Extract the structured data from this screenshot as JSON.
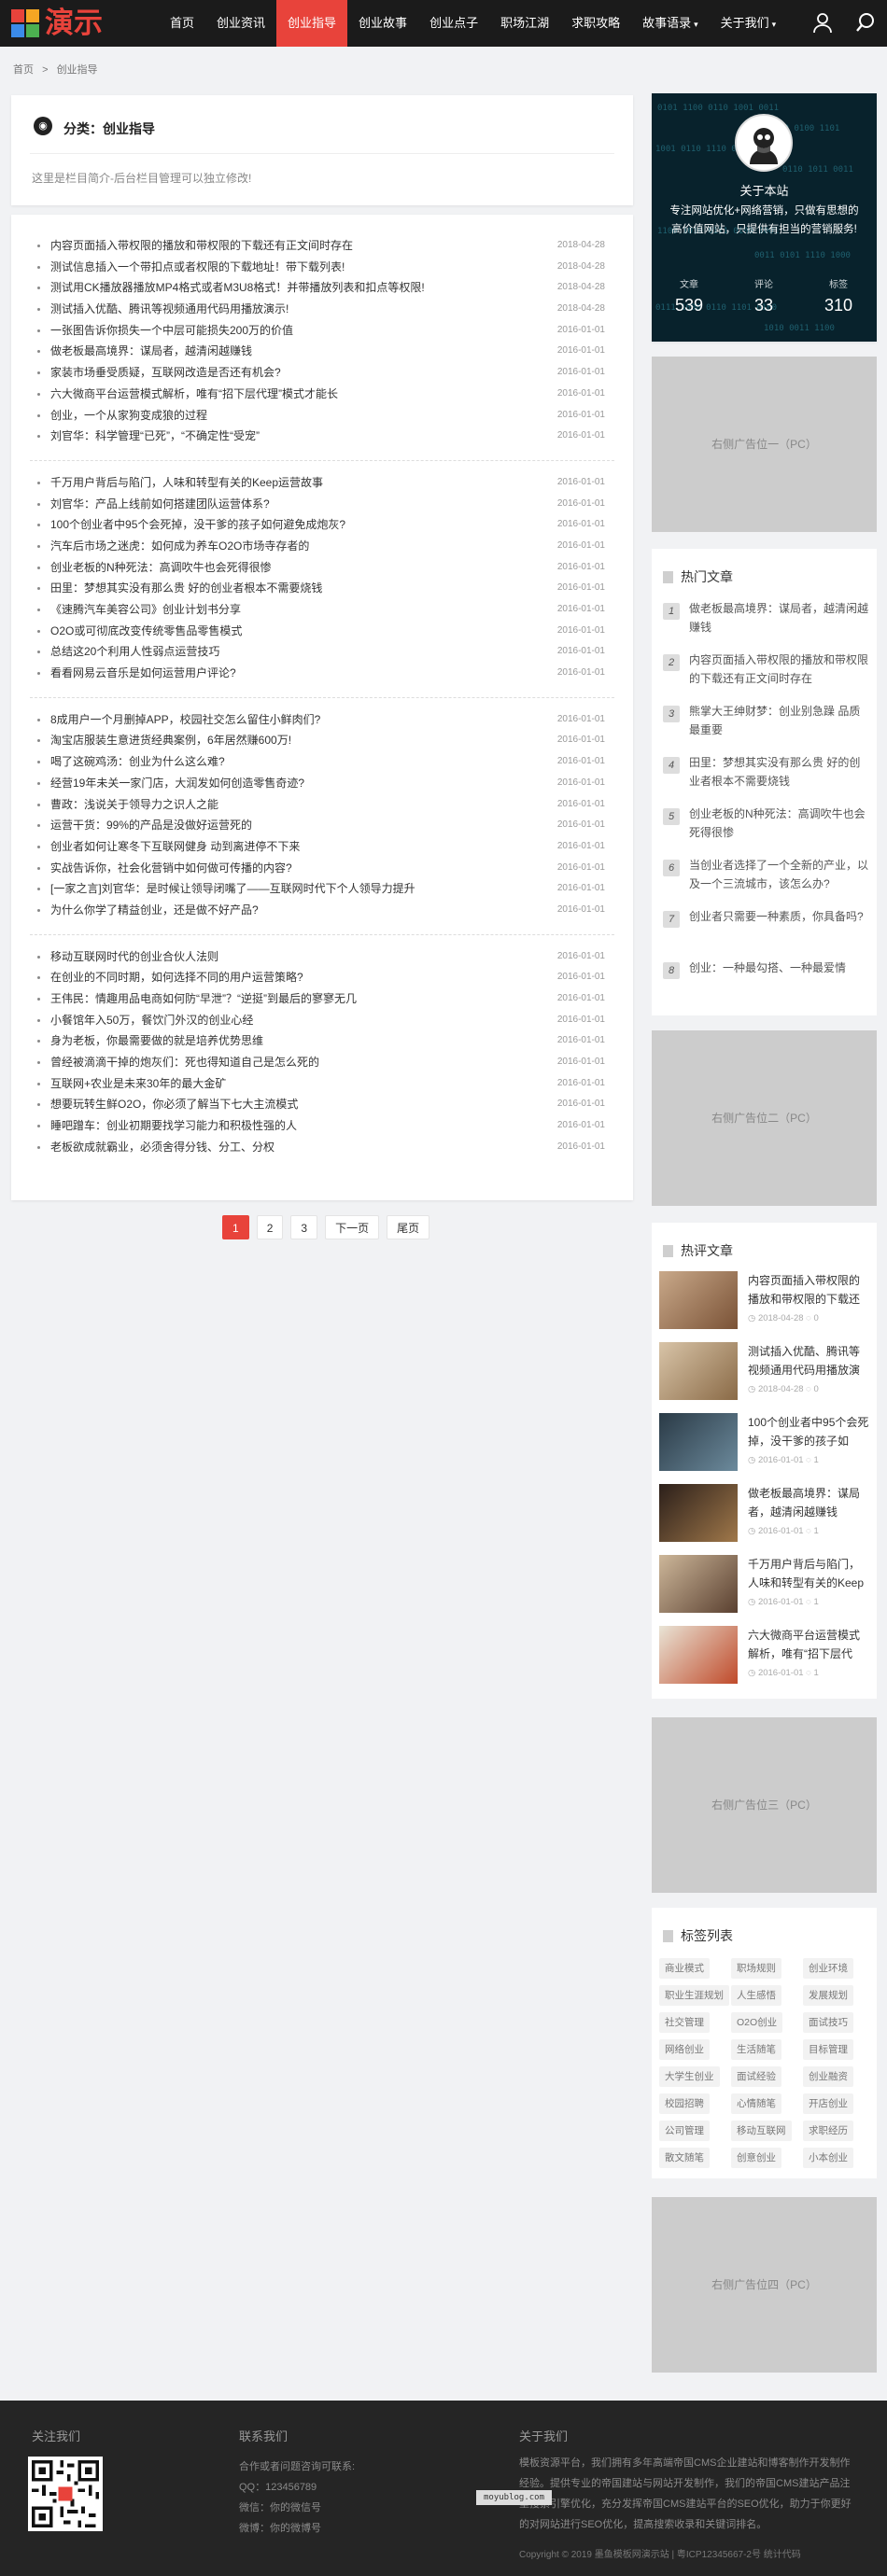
{
  "nav": {
    "logo_text": "演示",
    "items": [
      "首页",
      "创业资讯",
      "创业指导",
      "创业故事",
      "创业点子",
      "职场江湖",
      "求职攻略",
      "故事语录",
      "关于我们"
    ],
    "active_index": 2,
    "user_icon": "user-icon",
    "search_icon": "search-icon"
  },
  "breadcrumb": {
    "home": "首页",
    "sep": ">",
    "current": "创业指导"
  },
  "category": {
    "title": "分类：创业指导",
    "desc": "这里是栏目简介-后台栏目管理可以独立修改!"
  },
  "articles": [
    {
      "t": "内容页面插入带权限的播放和带权限的下载还有正文间时存在",
      "d": "2018-04-28"
    },
    {
      "t": "测试信息插入一个带扣点或者权限的下载地址！带下载列表!",
      "d": "2018-04-28"
    },
    {
      "t": "测试用CK播放器播放MP4格式或者M3U8格式！并带播放列表和扣点等权限!",
      "d": "2018-04-28"
    },
    {
      "t": "测试插入优酷、腾讯等视频通用代码用播放演示!",
      "d": "2018-04-28"
    },
    {
      "t": "一张图告诉你损失一个中层可能损失200万的价值",
      "d": "2016-01-01"
    },
    {
      "t": "做老板最高境界：谋局者，越清闲越赚钱",
      "d": "2016-01-01"
    },
    {
      "t": "家装市场垂受质疑，互联网改造是否还有机会?",
      "d": "2016-01-01"
    },
    {
      "t": "六大微商平台运营模式解析，唯有“招下层代理”模式才能长",
      "d": "2016-01-01"
    },
    {
      "t": "创业，一个从家狗变成狼的过程",
      "d": "2016-01-01"
    },
    {
      "t": "刘官华：科学管理“已死”，“不确定性“受宠”",
      "d": "2016-01-01"
    },
    {
      "t": "千万用户背后与陷门，人味和转型有关的Keep运营故事",
      "d": "2016-01-01"
    },
    {
      "t": "刘官华：产品上线前如何搭建团队运营体系?",
      "d": "2016-01-01"
    },
    {
      "t": "100个创业者中95个会死掉，没干爹的孩子如何避免成炮灰?",
      "d": "2016-01-01"
    },
    {
      "t": "汽车后市场之迷虎：如何成为养车O2O市场寺存者的",
      "d": "2016-01-01"
    },
    {
      "t": "创业老板的N种死法：高调吹牛也会死得很惨",
      "d": "2016-01-01"
    },
    {
      "t": "田里：梦想其实没有那么贵 好的创业者根本不需要烧钱",
      "d": "2016-01-01"
    },
    {
      "t": "《速腾汽车美容公司》创业计划书分享",
      "d": "2016-01-01"
    },
    {
      "t": "O2O或可彻底改变传统零售品零售模式",
      "d": "2016-01-01"
    },
    {
      "t": "总结这20个利用人性弱点运营技巧",
      "d": "2016-01-01"
    },
    {
      "t": "看看网易云音乐是如何运营用户评论?",
      "d": "2016-01-01"
    },
    {
      "t": "8成用户一个月删掉APP，校园社交怎么留住小鲜肉们?",
      "d": "2016-01-01"
    },
    {
      "t": "淘宝店服装生意进货经典案例，6年居然赚600万!",
      "d": "2016-01-01"
    },
    {
      "t": "喝了这碗鸡汤：创业为什么这么难?",
      "d": "2016-01-01"
    },
    {
      "t": "经营19年未关一家门店，大润发如何创造零售奇迹?",
      "d": "2016-01-01"
    },
    {
      "t": "曹政：浅说关于领导力之识人之能",
      "d": "2016-01-01"
    },
    {
      "t": "运营干货：99%的产品是没做好运营死的",
      "d": "2016-01-01"
    },
    {
      "t": "创业者如何让寒冬下互联网健身 动到离进停不下来",
      "d": "2016-01-01"
    },
    {
      "t": "实战告诉你，社会化营销中如何做可传播的内容?",
      "d": "2016-01-01"
    },
    {
      "t": "[一家之言]刘官华：是时候让领导闭嘴了——互联网时代下个人领导力提升",
      "d": "2016-01-01"
    },
    {
      "t": "为什么你学了精益创业，还是做不好产品?",
      "d": "2016-01-01"
    },
    {
      "t": "移动互联网时代的创业合伙人法则",
      "d": "2016-01-01"
    },
    {
      "t": "在创业的不同时期，如何选择不同的用户运营策略?",
      "d": "2016-01-01"
    },
    {
      "t": "王伟民：情趣用品电商如何防“早泄”？“逆挺”到最后的寥寥无几",
      "d": "2016-01-01"
    },
    {
      "t": "小餐馆年入50万，餐饮门外汉的创业心经",
      "d": "2016-01-01"
    },
    {
      "t": "身为老板，你最需要做的就是培养优势思维",
      "d": "2016-01-01"
    },
    {
      "t": "曾经被滴滴干掉的炮灰们：死也得知道自己是怎么死的",
      "d": "2016-01-01"
    },
    {
      "t": "互联网+农业是未来30年的最大金矿",
      "d": "2016-01-01"
    },
    {
      "t": "想要玩转生鲜O2O，你必须了解当下七大主流模式",
      "d": "2016-01-01"
    },
    {
      "t": "睡吧蹭车：创业初期要找学习能力和积极性强的人",
      "d": "2016-01-01"
    },
    {
      "t": "老板欲成就霸业，必须舍得分钱、分工、分权",
      "d": "2016-01-01"
    }
  ],
  "pagination": {
    "pages": [
      "1",
      "2",
      "3"
    ],
    "current": "1",
    "next": "下一页",
    "last": "尾页"
  },
  "about": {
    "title": "关于本站",
    "text": "专注网站优化+网络营销，只做有思想的高价值网站，只提供有担当的营销服务!",
    "stats": [
      {
        "label": "文章",
        "value": "539"
      },
      {
        "label": "评论",
        "value": "33"
      },
      {
        "label": "标签",
        "value": "310"
      }
    ]
  },
  "ads": [
    "右侧广告位一（PC）",
    "右侧广告位二（PC）",
    "右侧广告位三（PC）",
    "右侧广告位四（PC）"
  ],
  "hot": {
    "title": "热门文章",
    "items": [
      {
        "n": "1",
        "t": "做老板最高境界：谋局者，越清闲越赚钱"
      },
      {
        "n": "2",
        "t": "内容页面插入带权限的播放和带权限的下载还有正文间时存在"
      },
      {
        "n": "3",
        "t": "熊掌大王绅财梦：创业别急躁 品质最重要"
      },
      {
        "n": "4",
        "t": "田里：梦想其实没有那么贵 好的创业者根本不需要烧钱"
      },
      {
        "n": "5",
        "t": "创业老板的N种死法：高调吹牛也会死得很惨"
      },
      {
        "n": "6",
        "t": "当创业者选择了一个全新的产业，以及一个三流城市，该怎么办?"
      },
      {
        "n": "7",
        "t": "创业者只需要一种素质，你具备吗?"
      },
      {
        "n": "8",
        "t": "创业：一种最勾搭、一种最爱情"
      }
    ]
  },
  "comments": {
    "title": "热评文章",
    "items": [
      {
        "t": "内容页面插入带权限的播放和带权限的下载还",
        "d": "2018-04-28",
        "c": "0"
      },
      {
        "t": "测试插入优酷、腾讯等视频通用代码用播放演",
        "d": "2018-04-28",
        "c": "0"
      },
      {
        "t": "100个创业者中95个会死掉，没干爹的孩子如",
        "d": "2016-01-01",
        "c": "1"
      },
      {
        "t": "做老板最高境界：谋局者，越清闲越赚钱",
        "d": "2016-01-01",
        "c": "1"
      },
      {
        "t": "千万用户背后与陷门，人味和转型有关的Keep",
        "d": "2016-01-01",
        "c": "1"
      },
      {
        "t": "六大微商平台运营模式解析，唯有“招下层代",
        "d": "2016-01-01",
        "c": "1"
      }
    ]
  },
  "tags": {
    "title": "标签列表",
    "items": [
      "商业模式",
      "职场规则",
      "创业环境",
      "职业生涯规划",
      "人生感悟",
      "发展规划",
      "社交管理",
      "O2O创业",
      "面试技巧",
      "网络创业",
      "生活随笔",
      "目标管理",
      "大学生创业",
      "面试经验",
      "创业融资",
      "校园招聘",
      "心情随笔",
      "开店创业",
      "公司管理",
      "移动互联网",
      "求职经历",
      "散文随笔",
      "创意创业",
      "小本创业"
    ]
  },
  "footer": {
    "follow": "关注我们",
    "contact": "联系我们",
    "contact_lines": [
      "合作或者问题咨询可联系:",
      "QQ：123456789",
      "微信：你的微信号",
      "微博：你的微博号"
    ],
    "about": "关于我们",
    "about_text": "模板资源平台，我们拥有多年高端帝国CMS企业建站和博客制作开发制作经验。提供专业的帝国建站与网站开发制作，我们的帝国CMS建站产品注重搜索引擎优化，充分发挥帝国CMS建站平台的SEO优化，助力于你更好的对网站进行SEO优化，提高搜索收录和关键词排名。",
    "watermark": "moyublog.com",
    "copyright": "Copyright © 2019 墨鱼模板网演示站 | 粤ICP12345667-2号 统计代码"
  }
}
